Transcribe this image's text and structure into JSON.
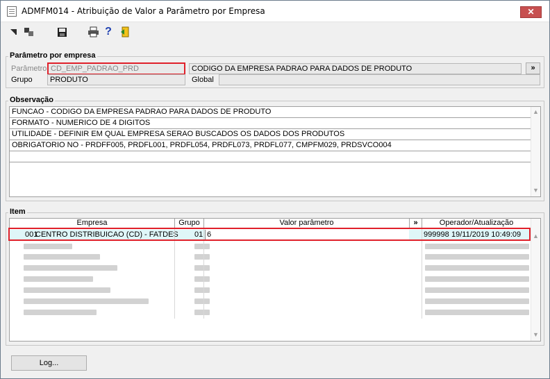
{
  "window": {
    "title": "ADMFM014 - Atribuição de Valor a Parâmetro por Empresa",
    "close_label": "✕"
  },
  "toolbar": {
    "icons": [
      "first-record-icon",
      "copy-icon",
      "save-icon",
      "print-icon",
      "help-icon",
      "exit-icon"
    ]
  },
  "parametro_group": {
    "title": "Parâmetro por empresa",
    "parametro_label": "Parâmetro",
    "parametro_value": "CD_EMP_PADRAO_PRD",
    "descricao_value": "CODIGO DA EMPRESA PADRAO PARA DADOS DE PRODUTO",
    "expand_label": "»",
    "grupo_label": "Grupo",
    "grupo_value": "PRODUTO",
    "global_label": "Global",
    "global_value": ""
  },
  "observacao_group": {
    "title": "Observação",
    "lines": [
      "FUNCAO - CODIGO DA EMPRESA PADRAO PARA DADOS DE PRODUTO",
      "FORMATO - NUMERICO DE 4 DIGITOS",
      "UTILIDADE - DEFINIR EM QUAL EMPRESA SERAO BUSCADOS OS DADOS DOS PRODUTOS",
      "OBRIGATORIO NO - PRDFF005, PRDFL001, PRDFL054, PRDFL073, PRDFL077, CMPFM029, PRDSVCO004",
      ""
    ]
  },
  "item_group": {
    "title": "Item",
    "columns": {
      "empresa": "Empresa",
      "grupo": "Grupo",
      "valor": "Valor parâmetro",
      "expand": "»",
      "operador": "Operador/Atualização"
    },
    "selected_row": {
      "codigo": "001",
      "empresa": "CENTRO DISTRIBUICAO (CD) - FATDES",
      "grupo": "01",
      "valor": "6",
      "operador": "999998",
      "atualizacao": "19/11/2019 10:49:09"
    }
  },
  "footer": {
    "log_button": "Log..."
  },
  "colors": {
    "highlight_border": "#e0202a",
    "selected_row": "#dff6f8"
  }
}
